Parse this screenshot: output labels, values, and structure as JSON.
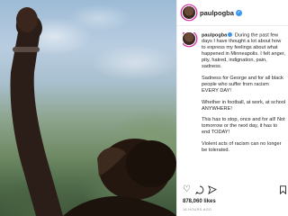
{
  "post": {
    "username": "paulpogba",
    "verified_icon": "verified-badge-icon",
    "caption_paragraphs": [
      "During the past few days I have thought a lot about how to express my feelings about what happened in Minneapolis. I felt anger, pity, hatred, indignation, pain, sadness.",
      "Sadness for George and for all black people who suffer from racism EVERY DAY!",
      "Whether in football, at work, at school ANYWHERE!",
      "This has to stop, once and for all! Not tomorrow or the next day, it has to end TODAY!",
      "Violent acts of racism can no longer be tolerated."
    ],
    "likes": "878,060 likes",
    "timestamp": "16 HOURS AGO"
  },
  "colors": {
    "accent": "#3897f0",
    "text": "#262626",
    "muted": "#8e8e8e",
    "story_ring": "#d6249f"
  },
  "icons": {
    "more": "more-options-icon",
    "like": "heart-icon",
    "comment": "comment-icon",
    "share": "share-icon",
    "save": "bookmark-icon"
  }
}
